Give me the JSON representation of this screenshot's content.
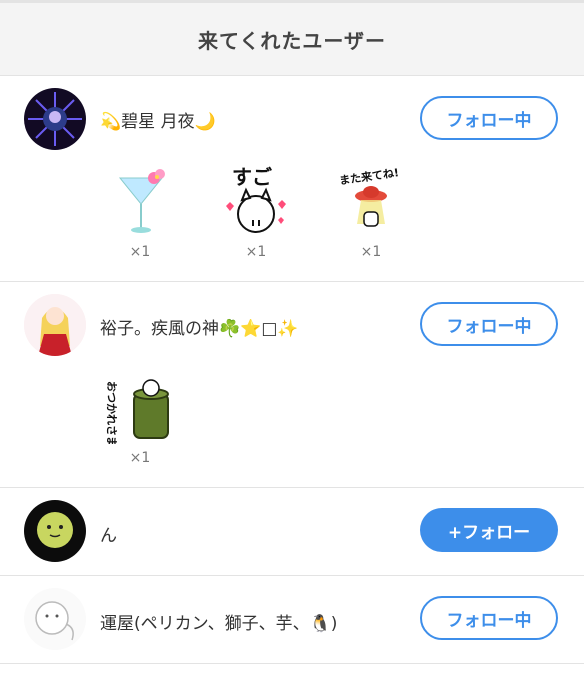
{
  "header": {
    "title": "来てくれたユーザー"
  },
  "users": [
    {
      "name": "💫碧星 月夜🌙",
      "button": "フォロー中",
      "gifts": [
        {
          "icon": "cocktail-gift-icon",
          "count": "×1"
        },
        {
          "icon": "sugoi-cat-gift-icon",
          "count": "×1"
        },
        {
          "icon": "ufo-mata-kite-ne-gift-icon",
          "count": "×1"
        }
      ],
      "gift_texts": [
        "すご",
        "また来てね!"
      ]
    },
    {
      "name": "裕子。疾風の神☘️⭐□✨",
      "button": "フォロー中",
      "gifts": [
        {
          "icon": "otsukaresama-cat-gift-icon",
          "count": "×1"
        }
      ],
      "gift_texts": [
        "おつかれさま"
      ]
    },
    {
      "name": "ん",
      "button": "+フォロー",
      "gifts": []
    },
    {
      "name": "運屋(ペリカン、獅子、芋、🐧)",
      "button": "フォロー中",
      "gifts": []
    }
  ],
  "colors": {
    "accent": "#3d8eea",
    "divider": "#e3e3e3",
    "header_bg": "#f4f4f4"
  }
}
